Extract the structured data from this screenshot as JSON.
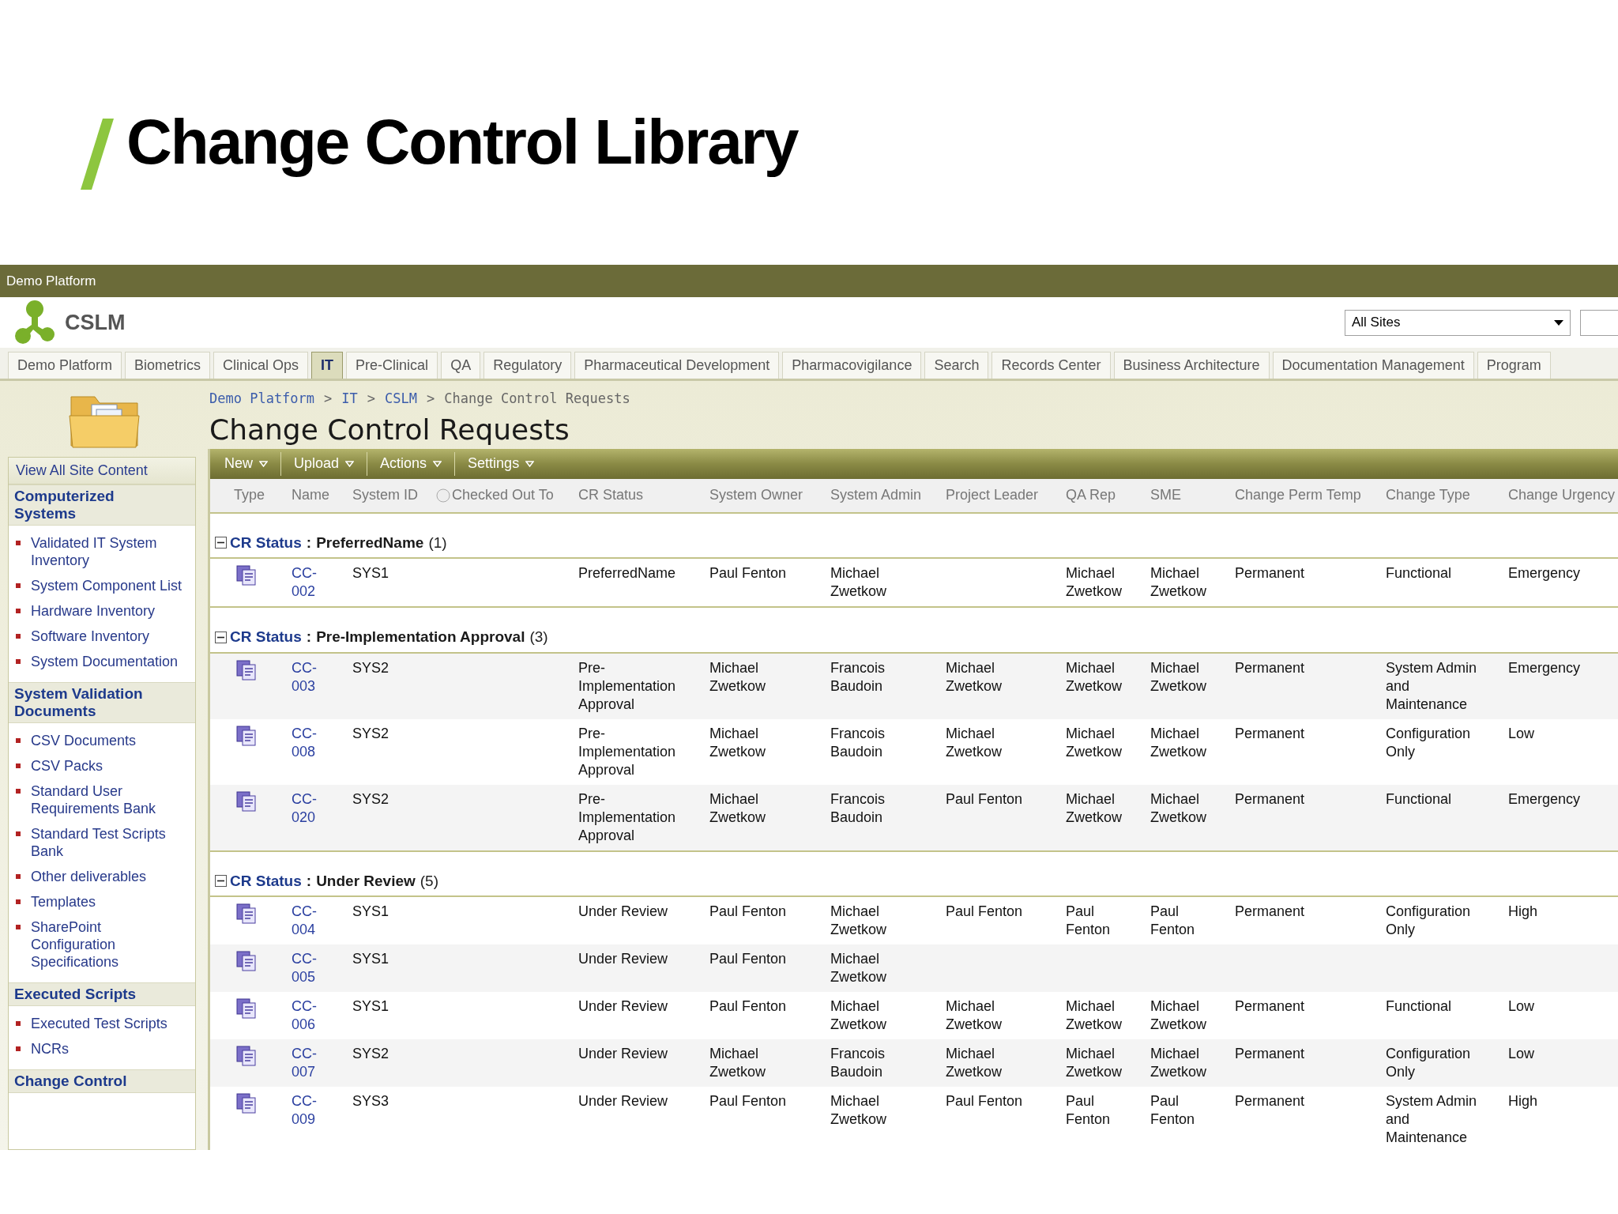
{
  "slide_title": "Change Control Library",
  "top_bar": {
    "title": "Demo Platform"
  },
  "header": {
    "logo_text": "CSLM",
    "site_selector": {
      "value": "All Sites"
    }
  },
  "nav_tabs": [
    {
      "label": "Demo Platform",
      "selected": false
    },
    {
      "label": "Biometrics",
      "selected": false
    },
    {
      "label": "Clinical Ops",
      "selected": false
    },
    {
      "label": "IT",
      "selected": true
    },
    {
      "label": "Pre-Clinical",
      "selected": false
    },
    {
      "label": "QA",
      "selected": false
    },
    {
      "label": "Regulatory",
      "selected": false
    },
    {
      "label": "Pharmaceutical Development",
      "selected": false
    },
    {
      "label": "Pharmacovigilance",
      "selected": false
    },
    {
      "label": "Search",
      "selected": false
    },
    {
      "label": "Records Center",
      "selected": false
    },
    {
      "label": "Business Architecture",
      "selected": false
    },
    {
      "label": "Documentation Management",
      "selected": false
    },
    {
      "label": "Program",
      "selected": false
    }
  ],
  "breadcrumb": {
    "separator": ">",
    "items": [
      {
        "label": "Demo Platform",
        "current": false
      },
      {
        "label": "IT",
        "current": false
      },
      {
        "label": "CSLM",
        "current": false
      },
      {
        "label": "Change Control Requests",
        "current": true
      }
    ]
  },
  "page_title": "Change Control Requests",
  "sidebar": {
    "view_all": "View All Site Content",
    "sections": [
      {
        "heading": "Computerized Systems",
        "items": [
          "Validated IT System Inventory",
          "System Component List",
          "Hardware Inventory",
          "Software Inventory",
          "System Documentation"
        ]
      },
      {
        "heading": "System Validation Documents",
        "items": [
          "CSV Documents",
          "CSV Packs",
          "Standard User Requirements Bank",
          "Standard Test Scripts Bank",
          "Other deliverables",
          "Templates",
          "SharePoint Configuration Specifications"
        ]
      },
      {
        "heading": "Executed Scripts",
        "items": [
          "Executed Test Scripts",
          "NCRs"
        ]
      },
      {
        "heading": "Change Control"
      }
    ]
  },
  "toolbar": [
    "New",
    "Upload",
    "Actions",
    "Settings"
  ],
  "columns": [
    "Type",
    "Name",
    "System ID",
    "Checked Out To",
    "CR Status",
    "System Owner",
    "System Admin",
    "Project Leader",
    "QA Rep",
    "SME",
    "Change Perm Temp",
    "Change Type",
    "Change Urgency"
  ],
  "groups": [
    {
      "label": "CR Status",
      "separator": ":",
      "value": "PreferredName",
      "count": "(1)",
      "expanded": true,
      "rows": [
        {
          "name": "CC-002",
          "system_id": "SYS1",
          "cr_status": "PreferredName",
          "system_owner": "Paul Fenton",
          "system_admin": "Michael Zwetkow",
          "qa_rep": "Michael Zwetkow",
          "sme": "Michael Zwetkow",
          "change_perm_temp": "Permanent",
          "change_type": "Functional",
          "change_urgency": "Emergency"
        }
      ]
    },
    {
      "label": "CR Status",
      "separator": ":",
      "value": "Pre-Implementation Approval",
      "count": "(3)",
      "expanded": true,
      "rows": [
        {
          "name": "CC-003",
          "system_id": "SYS2",
          "cr_status": "Pre-Implementation Approval",
          "system_owner": "Michael Zwetkow",
          "system_admin": "Francois Baudoin",
          "project_leader": "Michael Zwetkow",
          "qa_rep": "Michael Zwetkow",
          "sme": "Michael Zwetkow",
          "change_perm_temp": "Permanent",
          "change_type": "System Admin and Maintenance",
          "change_urgency": "Emergency"
        },
        {
          "name": "CC-008",
          "system_id": "SYS2",
          "cr_status": "Pre-Implementation Approval",
          "system_owner": "Michael Zwetkow",
          "system_admin": "Francois Baudoin",
          "project_leader": "Michael Zwetkow",
          "qa_rep": "Michael Zwetkow",
          "sme": "Michael Zwetkow",
          "change_perm_temp": "Permanent",
          "change_type": "Configuration Only",
          "change_urgency": "Low"
        },
        {
          "name": "CC-020",
          "system_id": "SYS2",
          "cr_status": "Pre-Implementation Approval",
          "system_owner": "Michael Zwetkow",
          "system_admin": "Francois Baudoin",
          "project_leader": "Paul Fenton",
          "qa_rep": "Michael Zwetkow",
          "sme": "Michael Zwetkow",
          "change_perm_temp": "Permanent",
          "change_type": "Functional",
          "change_urgency": "Emergency"
        }
      ]
    },
    {
      "label": "CR Status",
      "separator": ":",
      "value": "Under Review",
      "count": "(5)",
      "expanded": true,
      "rows": [
        {
          "name": "CC-004",
          "system_id": "SYS1",
          "cr_status": "Under Review",
          "system_owner": "Paul Fenton",
          "system_admin": "Michael Zwetkow",
          "project_leader": "Paul Fenton",
          "qa_rep": "Paul Fenton",
          "sme": "Paul Fenton",
          "change_perm_temp": "Permanent",
          "change_type": "Configuration Only",
          "change_urgency": "High"
        },
        {
          "name": "CC-005",
          "system_id": "SYS1",
          "cr_status": "Under Review",
          "system_owner": "Paul Fenton",
          "system_admin": "Michael Zwetkow"
        },
        {
          "name": "CC-006",
          "system_id": "SYS1",
          "cr_status": "Under Review",
          "system_owner": "Paul Fenton",
          "system_admin": "Michael Zwetkow",
          "project_leader": "Michael Zwetkow",
          "qa_rep": "Michael Zwetkow",
          "sme": "Michael Zwetkow",
          "change_perm_temp": "Permanent",
          "change_type": "Functional",
          "change_urgency": "Low"
        },
        {
          "name": "CC-007",
          "system_id": "SYS2",
          "cr_status": "Under Review",
          "system_owner": "Michael Zwetkow",
          "system_admin": "Francois Baudoin",
          "project_leader": "Michael Zwetkow",
          "qa_rep": "Michael Zwetkow",
          "sme": "Michael Zwetkow",
          "change_perm_temp": "Permanent",
          "change_type": "Configuration Only",
          "change_urgency": "Low"
        },
        {
          "name": "CC-009",
          "system_id": "SYS3",
          "cr_status": "Under Review",
          "system_owner": "Paul Fenton",
          "system_admin": "Michael Zwetkow",
          "project_leader": "Paul Fenton",
          "qa_rep": "Paul Fenton",
          "sme": "Paul Fenton",
          "change_perm_temp": "Permanent",
          "change_type": "System Admin and Maintenance",
          "change_urgency": "High"
        }
      ]
    }
  ]
}
